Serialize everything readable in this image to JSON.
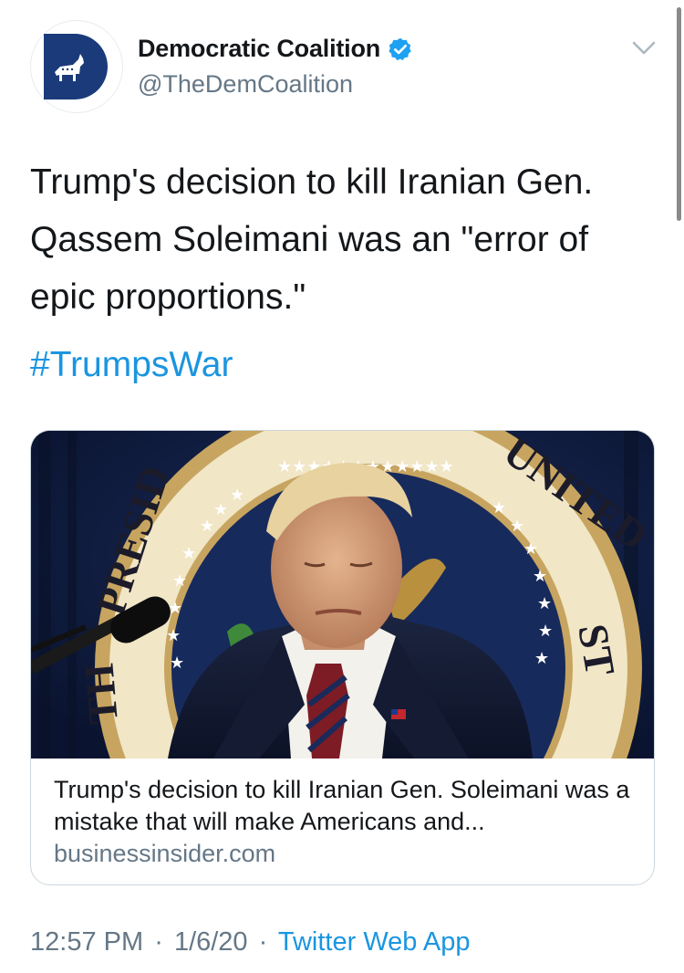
{
  "author": {
    "display_name": "Democratic Coalition",
    "handle": "@TheDemCoalition",
    "verified_icon": "verified-badge-icon",
    "avatar_icon": "donkey-logo-icon"
  },
  "tweet": {
    "text": "Trump's decision to kill Iranian Gen. Qassem Soleimani was an \"error of epic proportions.\"",
    "hashtag": "#TrumpsWar"
  },
  "card": {
    "title": "Trump's decision to kill Iranian Gen. Soleimani was a mistake that will make Americans and...",
    "domain": "businessinsider.com"
  },
  "footer": {
    "time": "12:57 PM",
    "date": "1/6/20",
    "separator": "·",
    "source_app": "Twitter Web App"
  },
  "colors": {
    "link_blue": "#1b95e0",
    "secondary_text": "#657786",
    "brand_navy": "#1a3a7a",
    "verified_blue": "#1da1f2"
  }
}
